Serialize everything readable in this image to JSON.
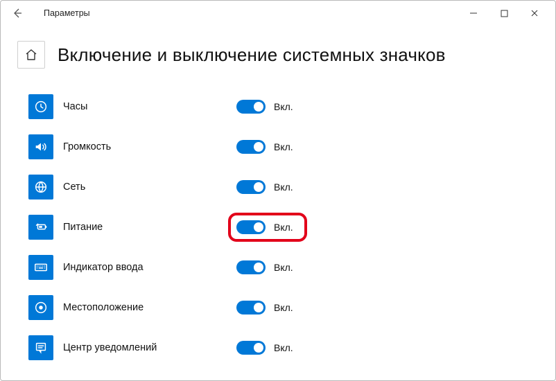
{
  "window": {
    "title": "Параметры"
  },
  "page": {
    "title": "Включение и выключение системных значков"
  },
  "toggle_on_label": "Вкл.",
  "items": [
    {
      "key": "clock",
      "label": "Часы",
      "icon": "clock",
      "on": true,
      "highlight": false
    },
    {
      "key": "volume",
      "label": "Громкость",
      "icon": "volume",
      "on": true,
      "highlight": false
    },
    {
      "key": "network",
      "label": "Сеть",
      "icon": "globe",
      "on": true,
      "highlight": false
    },
    {
      "key": "power",
      "label": "Питание",
      "icon": "power",
      "on": true,
      "highlight": true
    },
    {
      "key": "input",
      "label": "Индикатор ввода",
      "icon": "keyboard",
      "on": true,
      "highlight": false
    },
    {
      "key": "location",
      "label": "Местоположение",
      "icon": "location",
      "on": true,
      "highlight": false
    },
    {
      "key": "action",
      "label": "Центр уведомлений",
      "icon": "action",
      "on": true,
      "highlight": false
    }
  ]
}
